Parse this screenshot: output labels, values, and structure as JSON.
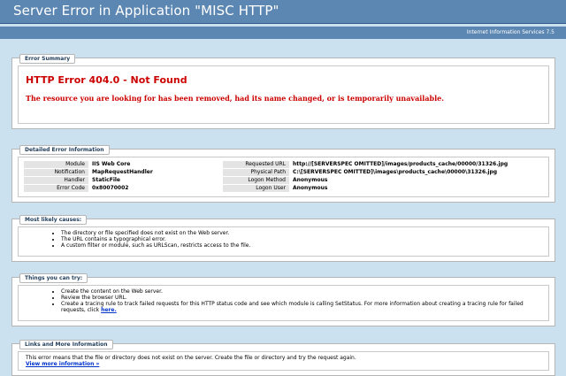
{
  "header": {
    "title": "Server Error in Application \"MISC HTTP\""
  },
  "server": {
    "label": "Internet Information Services 7.5"
  },
  "summary": {
    "legend": "Error Summary",
    "title": "HTTP Error 404.0 - Not Found",
    "message": "The resource you are looking for has been removed, had its name changed, or is temporarily unavailable."
  },
  "detail": {
    "legend": "Detailed Error Information",
    "left": [
      {
        "k": "Module",
        "v": "IIS Web Core"
      },
      {
        "k": "Notification",
        "v": "MapRequestHandler"
      },
      {
        "k": "Handler",
        "v": "StaticFile"
      },
      {
        "k": "Error Code",
        "v": "0x80070002"
      }
    ],
    "right": [
      {
        "k": "Requested URL",
        "v": "http://[SERVERSPEC OMITTED]/images/products_cache/00000/31326.jpg"
      },
      {
        "k": "Physical Path",
        "v": "C:\\[SERVERSPEC OMITTED]\\images\\products_cache\\00000\\31326.jpg"
      },
      {
        "k": "Logon Method",
        "v": "Anonymous"
      },
      {
        "k": "Logon User",
        "v": "Anonymous"
      }
    ]
  },
  "causes": {
    "legend": "Most likely causes:",
    "items": [
      "The directory or file specified does not exist on the Web server.",
      "The URL contains a typographical error.",
      "A custom filter or module, such as URLScan, restricts access to the file."
    ]
  },
  "try": {
    "legend": "Things you can try:",
    "items": [
      "Create the content on the Web server.",
      "Review the browser URL.",
      "Create a tracing rule to track failed requests for this HTTP status code and see which module is calling SetStatus. For more information about creating a tracing rule for failed requests, click"
    ],
    "here_link": "here."
  },
  "links": {
    "legend": "Links and More Information",
    "text": "This error means that the file or directory does not exist on the server. Create the file or directory and try the request again.",
    "more_link": "View more information »"
  }
}
